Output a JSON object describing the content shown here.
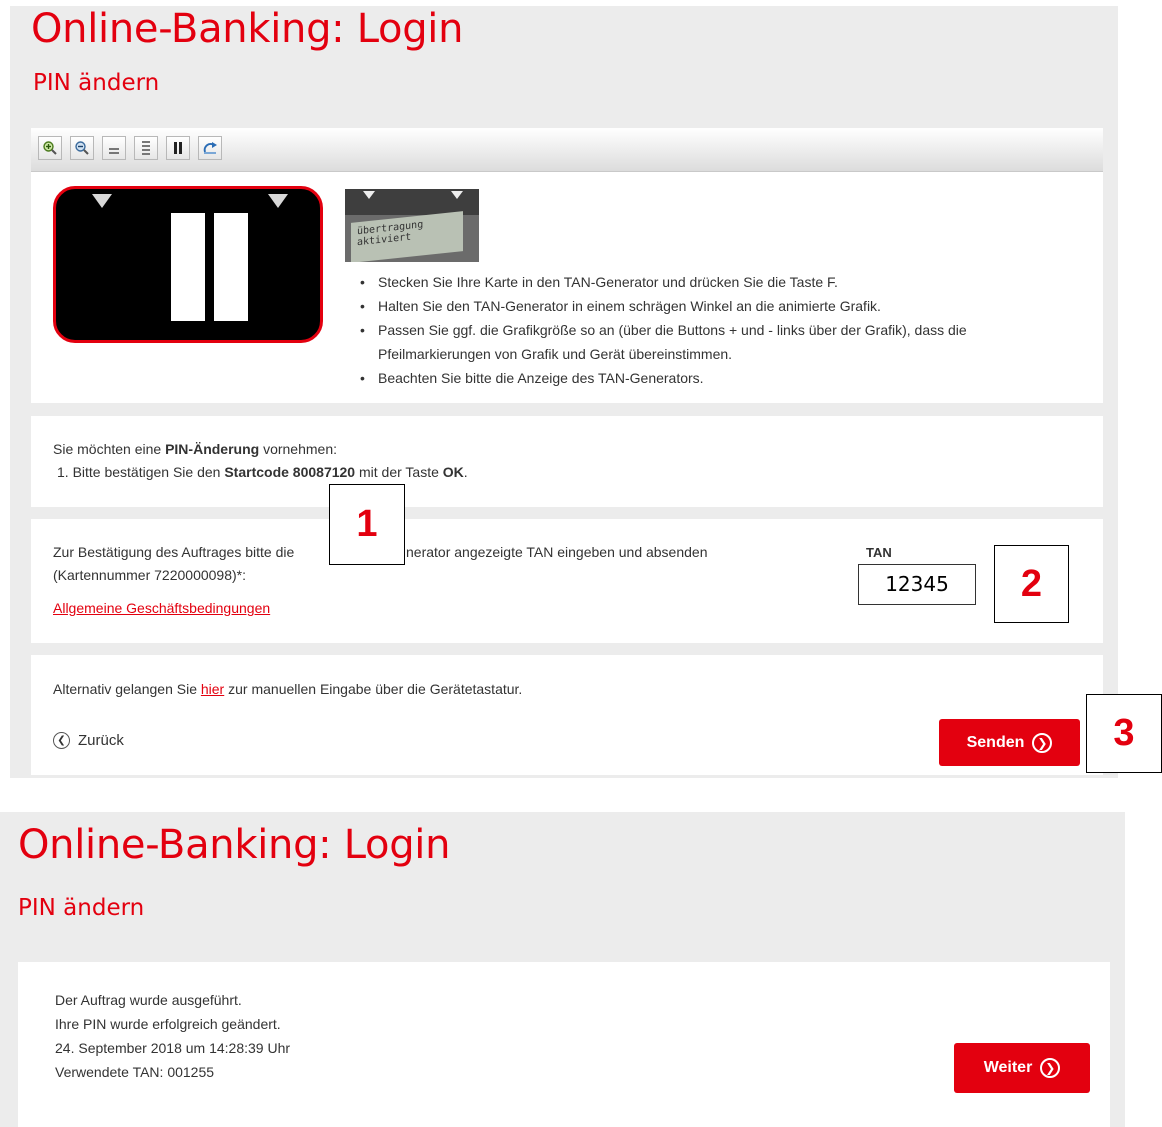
{
  "top": {
    "title": "Online-Banking: Login",
    "subtitle": "PIN ändern",
    "toolbar": [
      {
        "icon": "zoom-in-icon"
      },
      {
        "icon": "zoom-out-icon"
      },
      {
        "icon": "speed-slow-icon"
      },
      {
        "icon": "speed-fast-icon"
      },
      {
        "icon": "pause-icon"
      },
      {
        "icon": "reset-icon"
      }
    ],
    "device_screen": "übertragung aktiviert",
    "instructions": [
      "Stecken Sie Ihre Karte in den TAN-Generator und drücken Sie die Taste F.",
      "Halten Sie den TAN-Generator in einem schrägen Winkel an die animierte Grafik.",
      "Passen Sie ggf. die Grafikgröße so an (über die Buttons + und - links über der Grafik), dass die",
      "Pfeilmarkierungen von Grafik und Gerät übereinstimmen.",
      "Beachten Sie bitte die Anzeige des TAN-Generators."
    ],
    "pin_change": {
      "intro_pre": "Sie möchten eine ",
      "intro_bold": "PIN-Änderung",
      "intro_post": " vornehmen:",
      "step_pre": "1. Bitte bestätigen Sie den ",
      "step_bold": "Startcode 80087120",
      "step_mid": " mit der Taste ",
      "step_key": "OK",
      "step_end": "."
    },
    "confirm": {
      "line1_a": "Zur Bestätigung des Auftrages bitte die",
      "line1_b": "nerator angezeigte TAN eingeben und absenden",
      "line2": "(Kartennummer 7220000098)*:",
      "agb_link": "Allgemeine Geschäftsbedingungen",
      "tan_label": "TAN",
      "tan_value": "12345"
    },
    "alt": {
      "pre": "Alternativ gelangen Sie ",
      "link": "hier",
      "post": " zur manuellen Eingabe über die Gerätetastatur."
    },
    "back_label": "Zurück",
    "send_label": "Senden"
  },
  "annotations": [
    "1",
    "2",
    "3"
  ],
  "bottom": {
    "title": "Online-Banking: Login",
    "subtitle": "PIN ändern",
    "lines": [
      "Der Auftrag wurde ausgeführt.",
      "Ihre PIN wurde erfolgreich geändert.",
      "24. September 2018 um 14:28:39 Uhr",
      "Verwendete TAN: 001255"
    ],
    "next_label": "Weiter"
  },
  "colors": {
    "brand": "#e3000f",
    "panel": "#ececec",
    "text": "#333333"
  }
}
